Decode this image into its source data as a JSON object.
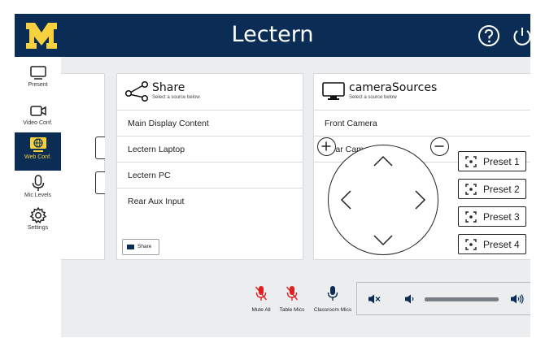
{
  "header": {
    "title": "Lectern",
    "logo_letter": "M",
    "help_icon": "help-circle-icon",
    "power_icon": "power-icon"
  },
  "colors": {
    "navy": "#0b2d55",
    "maize": "#f7d23e",
    "muted_red": "#e02020",
    "panel_bg": "#ebedef"
  },
  "sidebar": {
    "items": [
      {
        "label": "Present",
        "icon": "monitor-icon",
        "active": false
      },
      {
        "label": "Video Conf.",
        "icon": "video-camera-icon",
        "active": false
      },
      {
        "label": "Web Conf.",
        "icon": "web-conference-icon",
        "active": true
      },
      {
        "label": "Mic Levels",
        "icon": "microphone-icon",
        "active": false
      },
      {
        "label": "Settings",
        "icon": "gear-icon",
        "active": false
      }
    ]
  },
  "share_panel": {
    "title": "Share",
    "subtitle": "Select a source below",
    "sources": [
      "Main Display Content",
      "Lectern Laptop",
      "Lectern PC",
      "Rear Aux Input"
    ],
    "button_label": "Share"
  },
  "camera_panel": {
    "title": "cameraSources",
    "subtitle": "Select a source below",
    "sources": [
      "Front Camera",
      "Rear Camera"
    ],
    "presets": [
      "Preset 1",
      "Preset 2",
      "Preset 3",
      "Preset 4"
    ]
  },
  "audio": {
    "mics": [
      {
        "label": "Mute All",
        "muted": true
      },
      {
        "label": "Table Mics",
        "muted": true
      },
      {
        "label": "Classroom Mics",
        "muted": false
      }
    ],
    "volume_level": 0.8
  }
}
